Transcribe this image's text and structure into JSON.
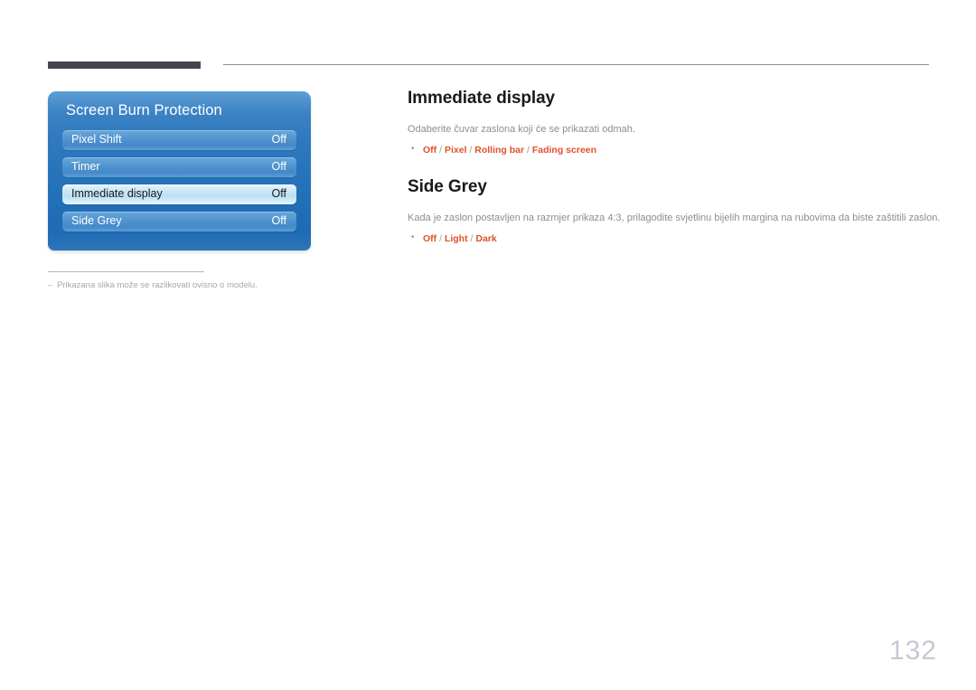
{
  "page": {
    "number": "132"
  },
  "osd": {
    "title": "Screen Burn Protection",
    "rows": [
      {
        "label": "Pixel Shift",
        "value": "Off",
        "selected": false
      },
      {
        "label": "Timer",
        "value": "Off",
        "selected": false
      },
      {
        "label": "Immediate display",
        "value": "Off",
        "selected": true
      },
      {
        "label": "Side Grey",
        "value": "Off",
        "selected": false
      }
    ]
  },
  "footnote": {
    "marker": "–",
    "text": "Prikazana slika može se razlikovati ovisno o modelu."
  },
  "sections": [
    {
      "title": "Immediate display",
      "description": "Odaberite čuvar zaslona koji će se prikazati odmah.",
      "options": [
        "Off",
        "Pixel",
        "Rolling bar",
        "Fading screen"
      ],
      "separator": "/"
    },
    {
      "title": "Side Grey",
      "description": "Kada je zaslon postavljen na razmjer prikaza 4:3, prilagodite svjetlinu bijelih margina na rubovima da biste zaštitili zaslon.",
      "options": [
        "Off",
        "Light",
        "Dark"
      ],
      "separator": "/"
    }
  ],
  "colors": {
    "accent_orange": "#e0512a",
    "panel_blue": "#2472b9",
    "header_bar": "#474451",
    "page_number": "#c9c7d4"
  }
}
